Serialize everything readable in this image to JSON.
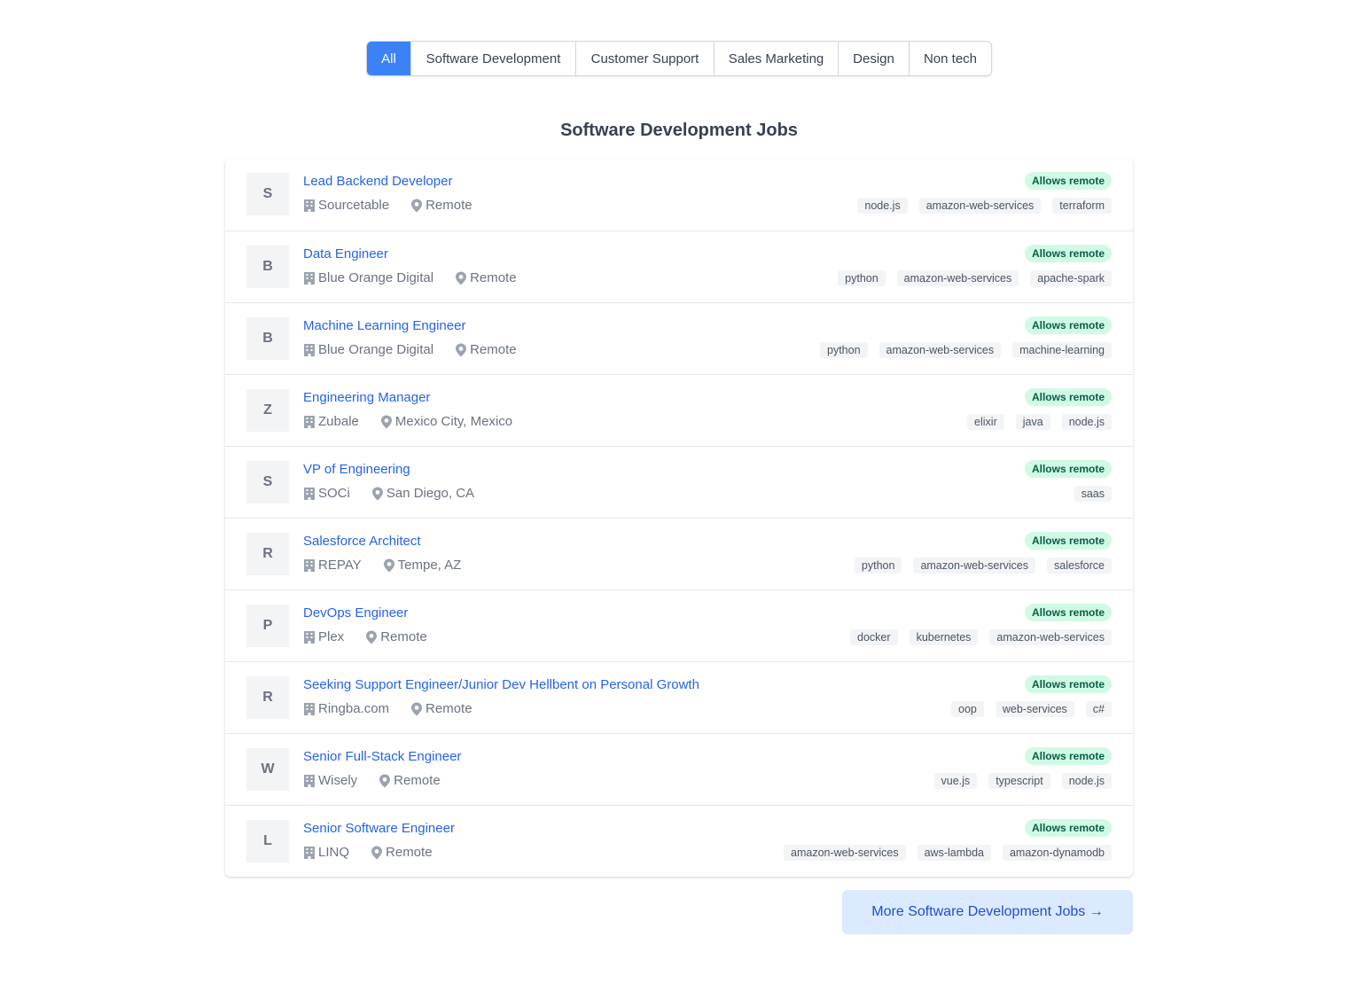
{
  "tabs": [
    {
      "label": "All",
      "active": true
    },
    {
      "label": "Software Development",
      "active": false
    },
    {
      "label": "Customer Support",
      "active": false
    },
    {
      "label": "Sales Marketing",
      "active": false
    },
    {
      "label": "Design",
      "active": false
    },
    {
      "label": "Non tech",
      "active": false
    }
  ],
  "heading": "Software Development Jobs",
  "jobs": [
    {
      "initial": "S",
      "title": "Lead Backend Developer",
      "company": "Sourcetable",
      "location": "Remote",
      "badge": "Allows remote",
      "tags": [
        "node.js",
        "amazon-web-services",
        "terraform"
      ]
    },
    {
      "initial": "B",
      "title": "Data Engineer",
      "company": "Blue Orange Digital",
      "location": "Remote",
      "badge": "Allows remote",
      "tags": [
        "python",
        "amazon-web-services",
        "apache-spark"
      ]
    },
    {
      "initial": "B",
      "title": "Machine Learning Engineer",
      "company": "Blue Orange Digital",
      "location": "Remote",
      "badge": "Allows remote",
      "tags": [
        "python",
        "amazon-web-services",
        "machine-learning"
      ]
    },
    {
      "initial": "Z",
      "title": "Engineering Manager",
      "company": "Zubale",
      "location": "Mexico City, Mexico",
      "badge": "Allows remote",
      "tags": [
        "elixir",
        "java",
        "node.js"
      ]
    },
    {
      "initial": "S",
      "title": "VP of Engineering",
      "company": "SOCi",
      "location": "San Diego, CA",
      "badge": "Allows remote",
      "tags": [
        "saas"
      ]
    },
    {
      "initial": "R",
      "title": "Salesforce Architect",
      "company": "REPAY",
      "location": "Tempe, AZ",
      "badge": "Allows remote",
      "tags": [
        "python",
        "amazon-web-services",
        "salesforce"
      ]
    },
    {
      "initial": "P",
      "title": "DevOps Engineer",
      "company": "Plex",
      "location": "Remote",
      "badge": "Allows remote",
      "tags": [
        "docker",
        "kubernetes",
        "amazon-web-services"
      ]
    },
    {
      "initial": "R",
      "title": "Seeking Support Engineer/Junior Dev Hellbent on Personal Growth",
      "company": "Ringba.com",
      "location": "Remote",
      "badge": "Allows remote",
      "tags": [
        "oop",
        "web-services",
        "c#"
      ]
    },
    {
      "initial": "W",
      "title": "Senior Full-Stack Engineer",
      "company": "Wisely",
      "location": "Remote",
      "badge": "Allows remote",
      "tags": [
        "vue.js",
        "typescript",
        "node.js"
      ]
    },
    {
      "initial": "L",
      "title": "Senior Software Engineer",
      "company": "LINQ",
      "location": "Remote",
      "badge": "Allows remote",
      "tags": [
        "amazon-web-services",
        "aws-lambda",
        "amazon-dynamodb"
      ]
    }
  ],
  "more_button": "More Software Development Jobs →",
  "icons": {
    "company": "building-icon",
    "location": "map-pin-icon"
  },
  "colors": {
    "accent": "#3b82f6",
    "link": "#2563eb",
    "badge_bg": "#d1fae5",
    "badge_text": "#065f46",
    "button_bg": "#dbeafe",
    "button_text": "#1d4ed8"
  }
}
